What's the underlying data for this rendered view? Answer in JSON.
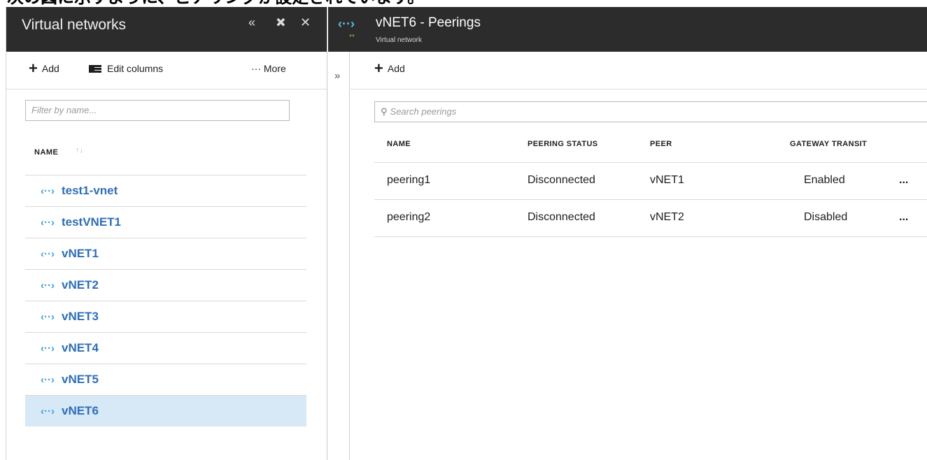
{
  "caption": "次の図に示すように、ピアリングが設定されています。",
  "left_blade": {
    "title": "Virtual networks",
    "header_buttons": {
      "collapse": "«",
      "pin": "✚",
      "close": "✕"
    },
    "toolbar": {
      "add": "Add",
      "edit_columns": "Edit columns",
      "more": "··· More"
    },
    "filter_placeholder": "Filter by name...",
    "column_header": "NAME",
    "sort_glyph": "↑↓",
    "vnets": [
      "test1-vnet",
      "testVNET1",
      "vNET1",
      "vNET2",
      "vNET3",
      "vNET4",
      "vNET5",
      "vNET6"
    ],
    "selected": "vNET6",
    "vnet_icon_glyph": "‹··›"
  },
  "right_blade": {
    "title": "vNET6 - Peerings",
    "subtitle": "Virtual network",
    "expand_glyph": "»",
    "toolbar": {
      "add": "Add"
    },
    "search_placeholder": "Search peerings",
    "columns": [
      "NAME",
      "PEERING STATUS",
      "PEER",
      "GATEWAY TRANSIT"
    ],
    "rows": [
      {
        "name": "peering1",
        "status": "Disconnected",
        "peer": "vNET1",
        "gateway_transit": "Enabled",
        "more": "..."
      },
      {
        "name": "peering2",
        "status": "Disconnected",
        "peer": "vNET2",
        "gateway_transit": "Disabled",
        "more": "..."
      }
    ]
  },
  "colors": {
    "header_bg": "#2c2c2c",
    "link": "#2f6fb5",
    "selected_row": "#d7e8f7",
    "vnet_icon": "#3aa3d6"
  }
}
